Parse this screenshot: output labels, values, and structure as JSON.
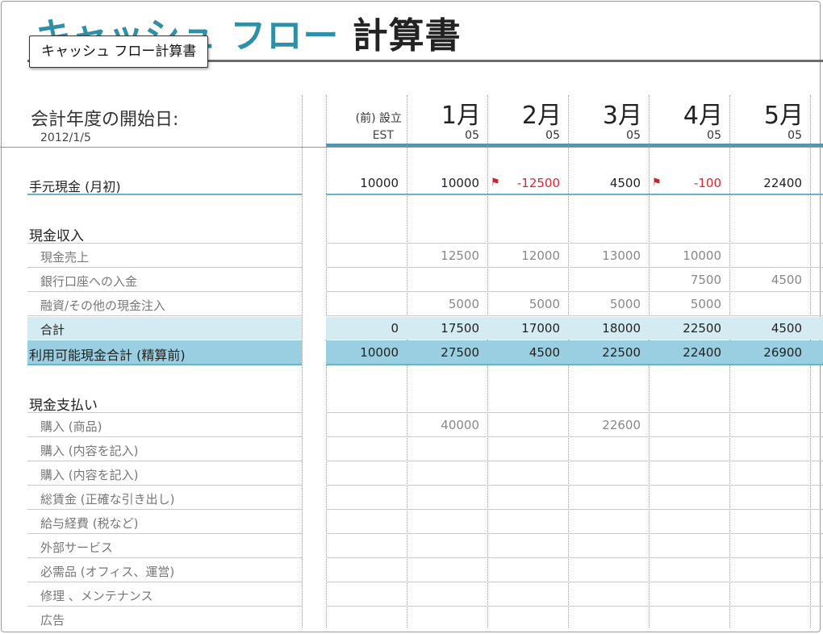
{
  "title": {
    "part1": "キャッシュ フロー",
    "part2": "計算書"
  },
  "tooltip": "キャッシュ フロー計算書",
  "fiscal_year": {
    "label": "会計年度の開始日:",
    "date": "2012/1/5"
  },
  "header": {
    "start_label": "(前) 設立",
    "start_sub": "EST",
    "months": [
      {
        "label": "1月",
        "year": "05"
      },
      {
        "label": "2月",
        "year": "05"
      },
      {
        "label": "3月",
        "year": "05"
      },
      {
        "label": "4月",
        "year": "05"
      },
      {
        "label": "5月",
        "year": "05"
      }
    ]
  },
  "cash_on_hand": {
    "label": "手元現金 (月初)",
    "values": [
      "10000",
      "10000",
      "-12500",
      "4500",
      "-100",
      "22400"
    ],
    "flagged": [
      false,
      false,
      true,
      false,
      true,
      false
    ]
  },
  "receipts": {
    "header": "現金収入",
    "rows": [
      {
        "label": "現金売上",
        "values": [
          "",
          "12500",
          "12000",
          "13000",
          "10000",
          ""
        ]
      },
      {
        "label": "銀行口座への入金",
        "values": [
          "",
          "",
          "",
          "",
          "7500",
          "4500"
        ]
      },
      {
        "label": "融資/その他の現金注入",
        "values": [
          "",
          "5000",
          "5000",
          "5000",
          "5000",
          ""
        ]
      }
    ],
    "total": {
      "label": "合計",
      "values": [
        "0",
        "17500",
        "17000",
        "18000",
        "22500",
        "4500"
      ]
    },
    "available": {
      "label": "利用可能現金合計 (精算前)",
      "values": [
        "10000",
        "27500",
        "4500",
        "22500",
        "22400",
        "26900"
      ]
    }
  },
  "payments": {
    "header": "現金支払い",
    "rows": [
      {
        "label": "購入 (商品)",
        "values": [
          "",
          "40000",
          "",
          "22600",
          "",
          ""
        ]
      },
      {
        "label": "購入 (内容を記入)",
        "values": [
          "",
          "",
          "",
          "",
          "",
          ""
        ]
      },
      {
        "label": "購入 (内容を記入)",
        "values": [
          "",
          "",
          "",
          "",
          "",
          ""
        ]
      },
      {
        "label": "総賃金 (正確な引き出し)",
        "values": [
          "",
          "",
          "",
          "",
          "",
          ""
        ]
      },
      {
        "label": "給与経費 (税など)",
        "values": [
          "",
          "",
          "",
          "",
          "",
          ""
        ]
      },
      {
        "label": "外部サービス",
        "values": [
          "",
          "",
          "",
          "",
          "",
          ""
        ]
      },
      {
        "label": "必需品 (オフィス、運営)",
        "values": [
          "",
          "",
          "",
          "",
          "",
          ""
        ]
      },
      {
        "label": "修理 、メンテナンス",
        "values": [
          "",
          "",
          "",
          "",
          "",
          ""
        ]
      },
      {
        "label": "広告",
        "values": [
          "",
          "",
          "",
          "",
          "",
          ""
        ]
      }
    ]
  },
  "colors": {
    "accent": "#2f8fa6",
    "total_band": "#d4ebf2",
    "available_band": "#99cfe0",
    "negative": "#e0252f"
  }
}
